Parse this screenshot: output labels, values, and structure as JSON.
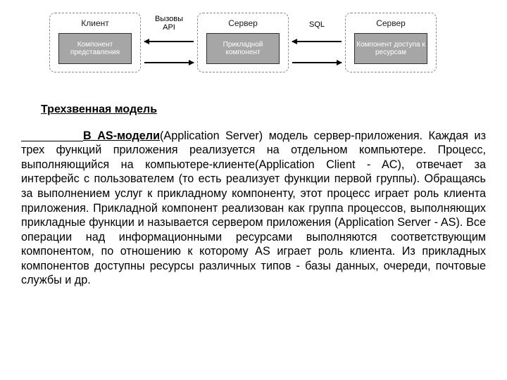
{
  "diagram": {
    "nodes": [
      {
        "title": "Клиент",
        "inner": "Компонент представления"
      },
      {
        "title": "Сервер",
        "inner": "Прикладной компонент"
      },
      {
        "title": "Сервер",
        "inner": "Компонент доступа к ресурсам"
      }
    ],
    "arrows": [
      {
        "label": "Вызовы\nAPI"
      },
      {
        "label": "SQL"
      }
    ]
  },
  "heading": "Трехзвенная модель",
  "lead": "В AS-модели",
  "body": "(Application Server) модель сервер-приложения. Каждая из трех функций приложения реализуется на отдельном компьютере. Процесс, выполняющийся на компьютере-клиенте(Application Client - AC), отвечает за интерфейс с пользователем (то есть реализует функции первой группы). Обращаясь за выполнением услуг к прикладному компоненту, этот процесс играет роль клиента приложения. Прикладной компонент реализован как группа процессов, выполняющих прикладные функции и называется сервером приложения (Application Server - AS). Все операции над информационными ресурсами выполняются соответствующим компонентом, по отношению к которому AS играет роль клиента. Из прикладных компонентов доступны ресурсы различных типов - базы данных, очереди, почтовые службы и др."
}
